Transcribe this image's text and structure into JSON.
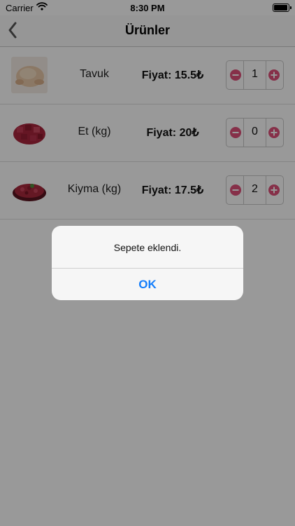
{
  "status_bar": {
    "carrier": "Carrier",
    "time": "8:30 PM",
    "battery_level": 0.85,
    "wifi_icon": "wifi-icon",
    "battery_icon": "battery-icon"
  },
  "nav": {
    "title": "Ürünler",
    "back_icon": "chevron-left-icon"
  },
  "products": [
    {
      "name": "Tavuk",
      "price": "Fiyat: 15.5₺",
      "quantity": "1",
      "image_icon": "chicken-image"
    },
    {
      "name": "Et (kg)",
      "price": "Fiyat: 20₺",
      "quantity": "0",
      "image_icon": "meat-cubes-image"
    },
    {
      "name": "Kiyma (kg)",
      "price": "Fiyat: 17.5₺",
      "quantity": "2",
      "image_icon": "ground-meat-image"
    }
  ],
  "stepper_icons": {
    "minus": "minus-circle-icon",
    "plus": "plus-circle-icon"
  },
  "colors": {
    "accent": "#147efb",
    "stepper_icon": "#e0507a"
  },
  "alert": {
    "message": "Sepete eklendi.",
    "ok_label": "OK"
  }
}
